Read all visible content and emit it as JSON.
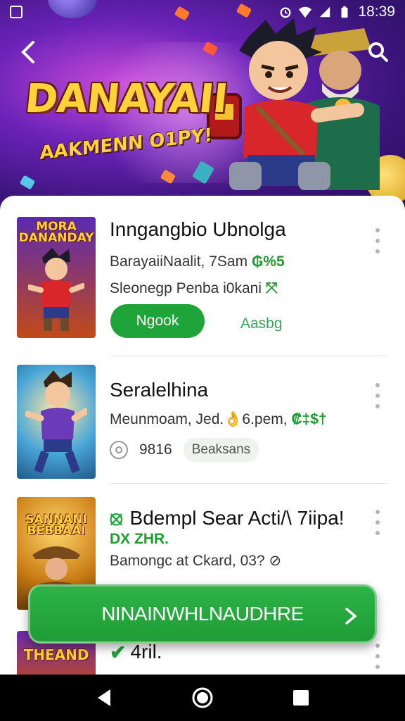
{
  "status_bar": {
    "time": "18:39"
  },
  "header": {
    "hero_title": "DANAYAII",
    "hero_subtitle": "AAKMENN O1PY!"
  },
  "items": [
    {
      "thumb_title": "MORA DANANDAY",
      "title": "Inngangbio Ubnolga",
      "meta1_text": "BarayaiiNaalit, 7Sam",
      "meta1_badge": "₲%5",
      "meta2_text": "Sleonegp Penba i0kani",
      "meta2_badge": "⤧",
      "primary_button": "Ngook",
      "secondary_button": "Aasbg"
    },
    {
      "title": "Seralelhina",
      "meta1_text": "Meunmoam, Jed.👌6.pem,",
      "meta1_badge": "₡‡$†",
      "rating": "9816",
      "chip": "Beaksans"
    },
    {
      "thumb_title": "SANNANI BEBBAAI",
      "title": "Bdempl Sear Acti/\\ 7iipa!",
      "title_badge": "⦻",
      "meta1_text": "DX ZHR.",
      "meta2_text": "Bamongc at Ckard, 03?",
      "meta2_badge": "⊘"
    },
    {
      "thumb_title": "THEAND",
      "title": "4ril.",
      "title_badge": "✔"
    }
  ],
  "cta": {
    "label": "NINAINWHLNAUDHRE"
  },
  "colors": {
    "accent_green": "#1fa43a",
    "hero_purple": "#6a22b8",
    "gold": "#ffd23a"
  }
}
